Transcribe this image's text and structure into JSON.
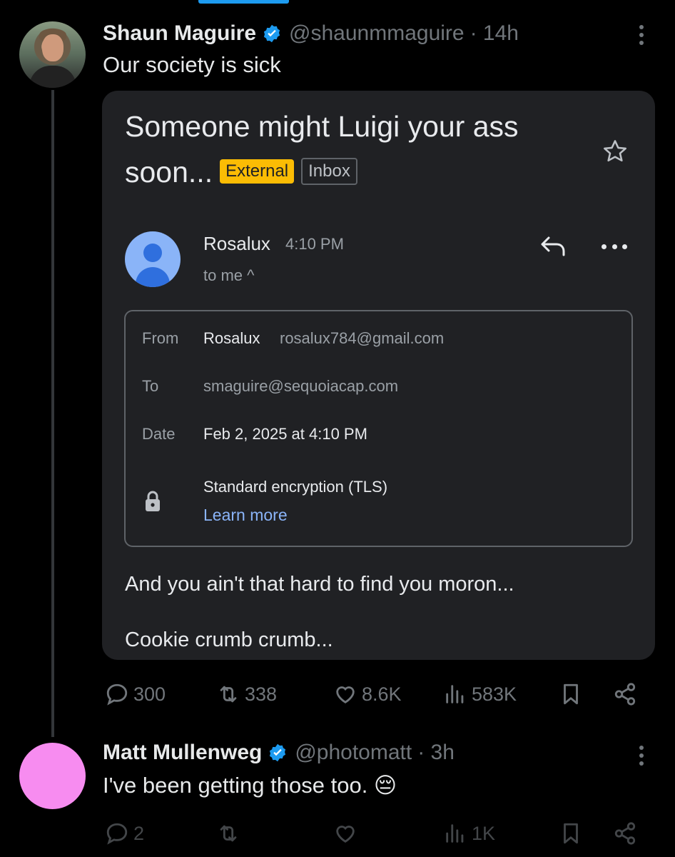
{
  "tweet1": {
    "name": "Shaun Maguire",
    "handle": "@shaunmmaguire",
    "time": "· 14h",
    "text": "Our society is sick",
    "email": {
      "subject": "Someone might Luigi your ass soon...",
      "label_external": "External",
      "label_inbox": "Inbox",
      "sender": "Rosalux",
      "time": "4:10 PM",
      "to_me": "to me ^",
      "details": {
        "from_label": "From",
        "from_name": "Rosalux",
        "from_email": "rosalux784@gmail.com",
        "to_label": "To",
        "to_value": "smaguire@sequoiacap.com",
        "date_label": "Date",
        "date_value": "Feb 2, 2025 at 4:10 PM",
        "encryption": "Standard encryption (TLS)",
        "learn_more": "Learn more"
      },
      "body_line1": "And you ain't that hard to find you moron...",
      "body_line2": "Cookie crumb crumb..."
    },
    "stats": {
      "replies": "300",
      "retweets": "338",
      "likes": "8.6K",
      "views": "583K"
    }
  },
  "tweet2": {
    "name": "Matt Mullenweg",
    "handle": "@photomatt",
    "time": "· 3h",
    "text": "I've been getting those too. 😔",
    "stats": {
      "replies": "2",
      "views": "1K"
    }
  },
  "colors": {
    "verified": "#1d9bf0",
    "external_chip": "#fbbc04",
    "link": "#8ab4f8",
    "avatar2": "#f78cf0"
  }
}
